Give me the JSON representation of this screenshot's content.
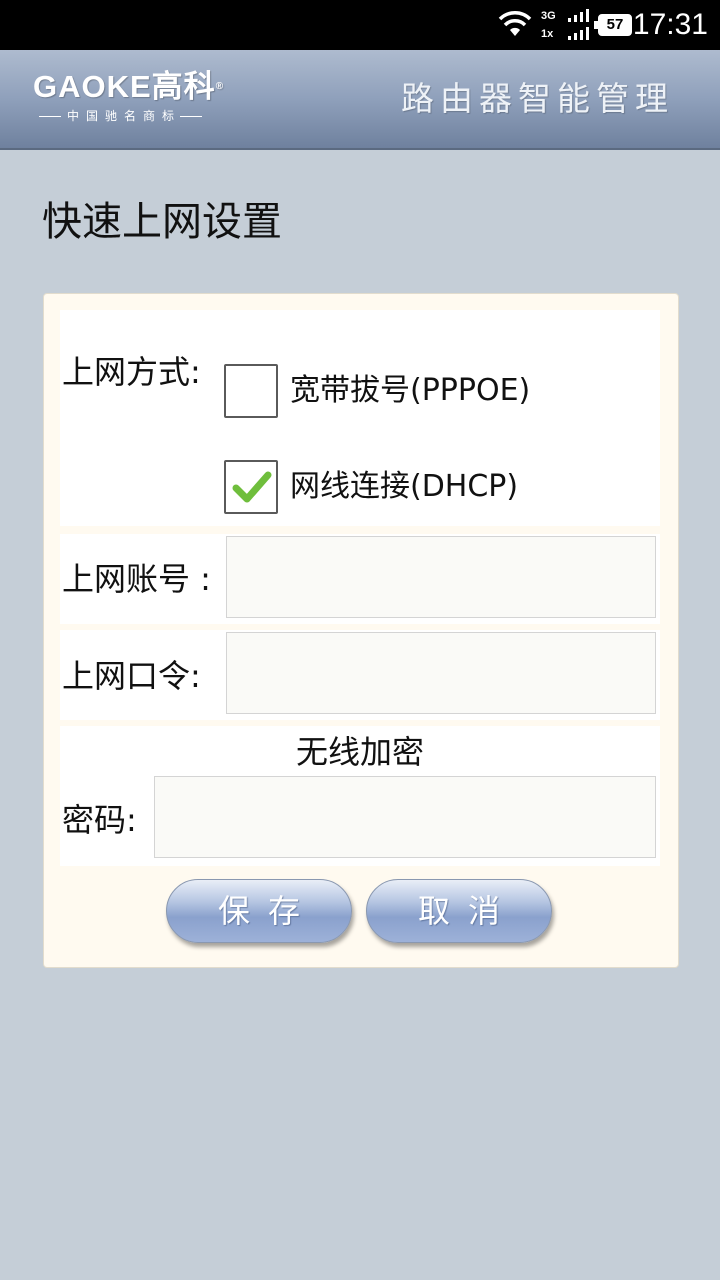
{
  "status_bar": {
    "time": "17:31",
    "battery": "57",
    "net_top": "3G",
    "net_bottom": "1x",
    "icons": [
      "wifi-icon",
      "signal-icon",
      "battery-icon"
    ]
  },
  "header": {
    "logo_text": "GAOKE高科",
    "logo_mark": "®",
    "logo_subtitle": "中国驰名商标",
    "title": "路由器智能管理"
  },
  "page": {
    "title": "快速上网设置"
  },
  "form": {
    "connection_label": "上网方式:",
    "options": [
      {
        "label": "宽带拔号(PPPOE)",
        "checked": false
      },
      {
        "label": "网线连接(DHCP)",
        "checked": true
      }
    ],
    "account_label": "上网账号 :",
    "account_value": "",
    "password_label": "上网口令:",
    "password_value": "",
    "wireless_heading": "无线加密",
    "wifi_password_label": "密码:",
    "wifi_password_value": ""
  },
  "buttons": {
    "save": "保存",
    "cancel": "取消"
  },
  "colors": {
    "background": "#c5ced7",
    "header": "#8fa0bb",
    "check": "#6fbe3c"
  }
}
